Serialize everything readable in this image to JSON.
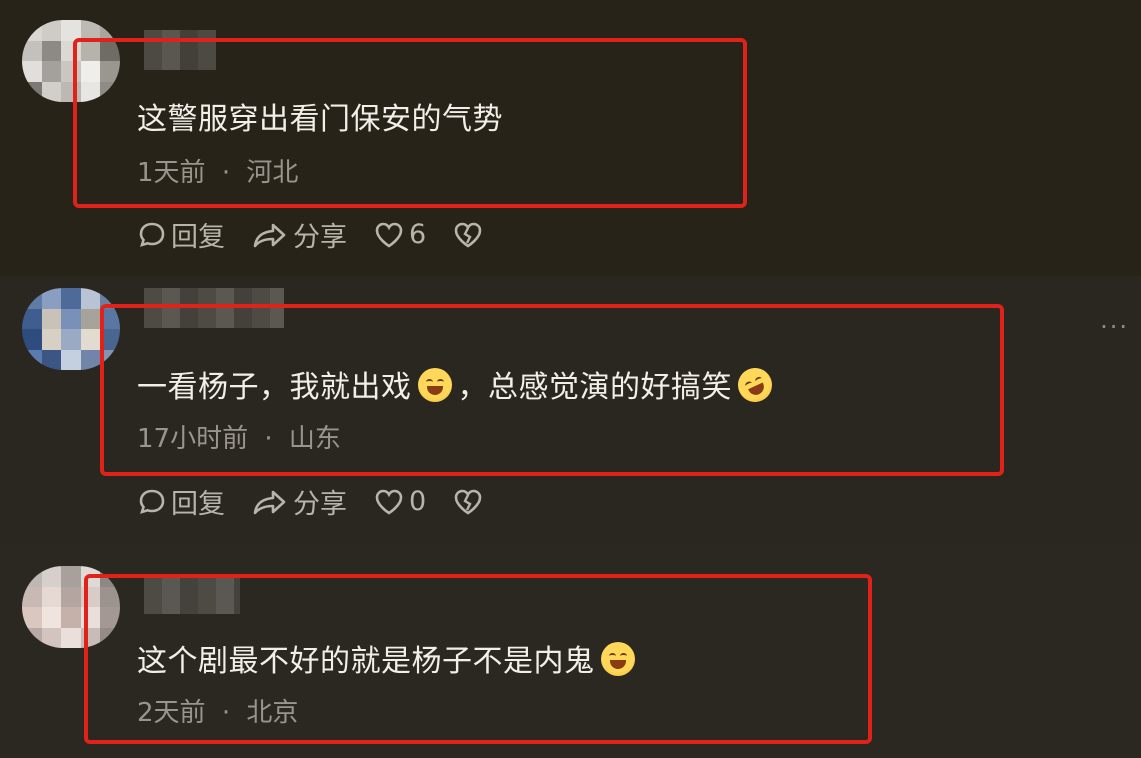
{
  "comments": [
    {
      "text": "这警服穿出看门保安的气势",
      "time": "1天前",
      "location": "河北",
      "reply_label": "回复",
      "share_label": "分享",
      "likes": "6"
    },
    {
      "text_part1": "一看杨子，我就出戏",
      "text_part2": "，总感觉演的好搞笑",
      "time": "17小时前",
      "location": "山东",
      "reply_label": "回复",
      "share_label": "分享",
      "likes": "0"
    },
    {
      "text": "这个剧最不好的就是杨子不是内鬼",
      "time": "2天前",
      "location": "北京"
    }
  ],
  "separator": "·",
  "more_label": "···",
  "colors": {
    "highlight": "#e0221b",
    "background": "#25221b",
    "text": "#f2efe8",
    "meta": "#9a958c"
  }
}
